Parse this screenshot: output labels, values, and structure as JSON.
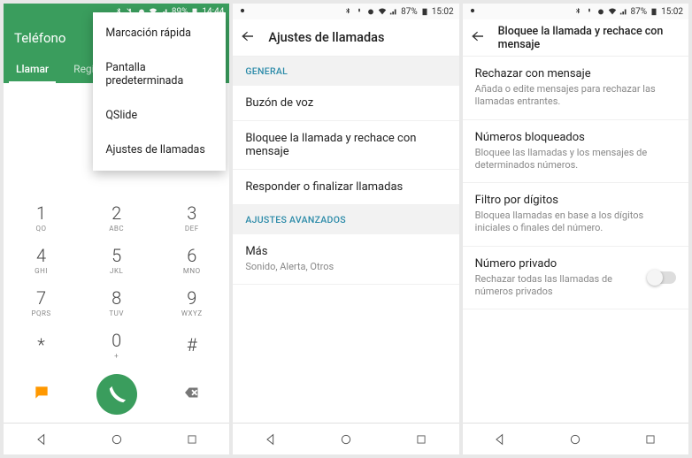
{
  "status1": {
    "battery": "89%",
    "time": "14:44"
  },
  "status2": {
    "battery": "87%",
    "time": "15:02"
  },
  "phone1": {
    "title": "Teléfono",
    "tabs": {
      "active": "Llamar",
      "other": "Regist"
    },
    "menu": [
      "Marcación rápida",
      "Pantalla predeterminada",
      "QSlide",
      "Ajustes de llamadas"
    ],
    "keys": [
      {
        "n": "1",
        "s": "QO"
      },
      {
        "n": "2",
        "s": "ABC"
      },
      {
        "n": "3",
        "s": "DEF"
      },
      {
        "n": "4",
        "s": "GHI"
      },
      {
        "n": "5",
        "s": "JKL"
      },
      {
        "n": "6",
        "s": "MNO"
      },
      {
        "n": "7",
        "s": "PQRS"
      },
      {
        "n": "8",
        "s": "TUV"
      },
      {
        "n": "9",
        "s": "WXYZ"
      },
      {
        "n": "*",
        "s": ""
      },
      {
        "n": "0",
        "s": "+"
      },
      {
        "n": "#",
        "s": ""
      }
    ]
  },
  "phone2": {
    "title": "Ajustes de llamadas",
    "sec1": "GENERAL",
    "items1": [
      "Buzón de voz",
      "Bloquee la llamada y rechace con mensaje",
      "Responder o finalizar llamadas"
    ],
    "sec2": "AJUSTES AVANZADOS",
    "more": {
      "title": "Más",
      "sub": "Sonido, Alerta, Otros"
    }
  },
  "phone3": {
    "title": "Bloquee la llamada y rechace con mensaje",
    "items": [
      {
        "t": "Rechazar con mensaje",
        "s": "Añada o edite mensajes para rechazar las llamadas entrantes."
      },
      {
        "t": "Números bloqueados",
        "s": "Bloquee las llamadas y los mensajes de determinados números."
      },
      {
        "t": "Filtro por dígitos",
        "s": "Bloquea llamadas en base a los dígitos iniciales o finales del número."
      },
      {
        "t": "Número privado",
        "s": "Rechazar todas las llamadas de números privados",
        "toggle": true
      }
    ]
  }
}
